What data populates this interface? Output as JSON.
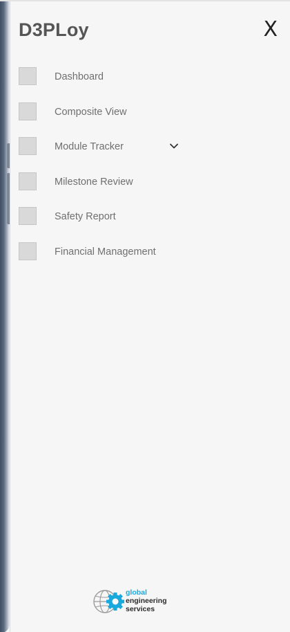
{
  "app": {
    "title": "D3PLoy",
    "close_label": "X"
  },
  "menu": {
    "items": [
      {
        "label": "Dashboard",
        "icon": "placeholder-square-icon"
      },
      {
        "label": "Composite View",
        "icon": "placeholder-square-icon"
      },
      {
        "label": "Module Tracker",
        "icon": "placeholder-square-icon",
        "expandable": true
      },
      {
        "label": "Milestone Review",
        "icon": "placeholder-square-icon"
      },
      {
        "label": "Safety Report",
        "icon": "placeholder-square-icon"
      },
      {
        "label": "Financial Management",
        "icon": "placeholder-square-icon"
      }
    ]
  },
  "footer": {
    "logo_line1": "global",
    "logo_line2": "engineering",
    "logo_line3": "services",
    "logo_icon": "globe-gear-icon"
  },
  "colors": {
    "background": "#f6f6f6",
    "brand_text": "#555555",
    "menu_text": "#6f6f6f",
    "icon_box": "#d9d9d9",
    "logo_accent": "#1aa9dd"
  }
}
